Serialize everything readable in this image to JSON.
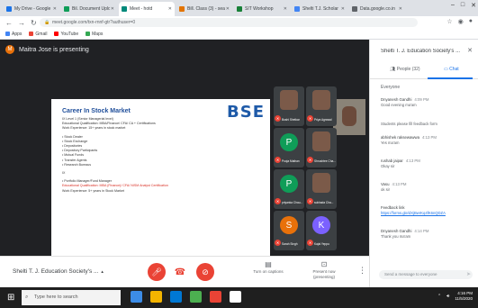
{
  "browser": {
    "tabs": [
      {
        "label": "My Drive - Google",
        "color": "#1a73e8",
        "active": false
      },
      {
        "label": "Bil. Document Upload",
        "color": "#0f9d58",
        "active": false
      },
      {
        "label": "Meet - hotd",
        "color": "#00897b",
        "active": true
      },
      {
        "label": "Bill. Class (3) - search",
        "color": "#e37400",
        "active": false
      },
      {
        "label": "SIT Workshop",
        "color": "#188038",
        "active": false
      },
      {
        "label": "Shelti T.J. Scholar",
        "color": "#4285f4",
        "active": false
      },
      {
        "label": "Data.google.co.in",
        "color": "#5f6368",
        "active": false
      }
    ],
    "url": "meet.google.com/txn-rnnf-gtr?authuser=0",
    "bookmarks": [
      {
        "label": "Apps",
        "color": "#4285f4"
      },
      {
        "label": "Gmail",
        "color": "#ea4335"
      },
      {
        "label": "YouTube",
        "color": "#ff0000"
      },
      {
        "label": "Maps",
        "color": "#34a853"
      }
    ]
  },
  "meet": {
    "presenter_initial": "M",
    "presenter_text": "Maitra Jose is presenting",
    "slide": {
      "logo": "BSE",
      "title": "Career In Stock Market",
      "lines": [
        {
          "text": "IX Level 1 (Senior Managerial level)",
          "red": false
        },
        {
          "text": "Educational Qualification: MBA/Finance/ CFA/ CA + Certifications",
          "red": false
        },
        {
          "text": "Work Experience: 15+ years in stock market",
          "red": false
        },
        {
          "gap": true
        },
        {
          "text": "• Stock Dealer",
          "red": false
        },
        {
          "text": "• Stock Exchange",
          "red": false
        },
        {
          "text": "• Depositories",
          "red": false
        },
        {
          "text": "• Depository Participants",
          "red": false
        },
        {
          "text": "• Mutual Funds",
          "red": false
        },
        {
          "text": "• Transfer Agents",
          "red": false
        },
        {
          "text": "• Research Bureaus",
          "red": false
        },
        {
          "gap": true
        },
        {
          "text": "IX",
          "red": false
        },
        {
          "gap": true
        },
        {
          "text": "• Portfolio Manager/Fund Manager",
          "red": false
        },
        {
          "text": "Educational Qualification: MBA (Finance)/ CFA/ NISM Analyst Certification",
          "red": true
        },
        {
          "text": "Work Experience: 5+ years in Stock Market",
          "red": false
        }
      ]
    },
    "participants": [
      {
        "name": "Bushi Shetkar",
        "initial": "",
        "color": "",
        "photo": true
      },
      {
        "name": "Priya Agrawal",
        "initial": "",
        "color": "",
        "photo": true
      },
      {
        "name": "Pooja Mathan",
        "initial": "P",
        "color": "#0f9d58",
        "photo": false
      },
      {
        "name": "Shrushtee Cha...",
        "initial": "",
        "color": "",
        "photo": true
      },
      {
        "name": "priyanka Chau...",
        "initial": "P",
        "color": "#0f9d58",
        "photo": false
      },
      {
        "name": "sukhada Cha...",
        "initial": "",
        "color": "",
        "photo": true
      },
      {
        "name": "Sarah Singh",
        "initial": "S",
        "color": "#e8710a",
        "photo": false
      },
      {
        "name": "Kajal Yeppu",
        "initial": "K",
        "color": "#7b61ff",
        "photo": false
      }
    ],
    "meeting_name": "Shelti T. J. Education Society's ...",
    "captions_label": "Turn on captions",
    "present_label": "Present now (presenting)"
  },
  "side": {
    "title": "Shelti T. J. Education Society's ...",
    "tabs": {
      "people": "People (32)",
      "chat": "Chat"
    },
    "people_count": "Everyone",
    "messages": [
      {
        "sender": "Dnyanesh Gandhi",
        "time": "4:09 PM",
        "body": "Good evening ma'am"
      },
      {
        "sender": "",
        "time": "",
        "body": "Students please fill feedback form"
      },
      {
        "sender": "abhishek raksewawwa",
        "time": "4:13 PM",
        "body": "Yes ma'am"
      },
      {
        "sender": "rushab jaipar",
        "time": "4:13 PM",
        "body": "Okay sir"
      },
      {
        "sender": "Vasu",
        "time": "4:13 PM",
        "body": "ok sir"
      },
      {
        "sender": "Feedback link",
        "time": "",
        "body": "https://forms.gle/dXjBwrKq4fK6nQDZA",
        "link": true
      },
      {
        "sender": "Dnyanesh Gandhi",
        "time": "4:14 PM",
        "body": "Thank you ma'am"
      }
    ],
    "compose_placeholder": "Send a message to everyone"
  },
  "taskbar": {
    "search_placeholder": "Type here to search",
    "time": "4:16 PM",
    "date": "11/5/2020",
    "icons": [
      "#3c8ce7",
      "#f4b400",
      "#0078d4",
      "#4caf50",
      "#ea4335",
      "#ffffff"
    ]
  }
}
